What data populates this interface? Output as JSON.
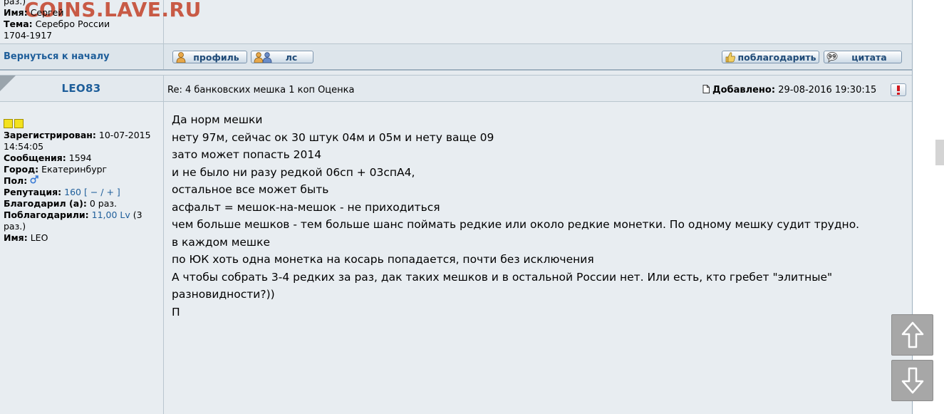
{
  "watermark": "COINS.LAVE.RU",
  "prev_user": {
    "times_suffix": "раз.)",
    "name_label": "Имя:",
    "name_value": "Сергей",
    "topic_label": "Тема:",
    "topic_value": "Серебро России",
    "topic_value2": "1704-1917"
  },
  "nav": {
    "back_to_top": "Вернуться к началу",
    "profile_button": "профиль",
    "pm_button": "лс",
    "thank_button": "поблагодарить",
    "quote_button": "цитата"
  },
  "post": {
    "author": "LEO83",
    "subject": "Re: 4 банковских мешка 1 коп Оценка",
    "added_label": "Добавлено:",
    "added_value": "29-08-2016 19:30:15",
    "report_icon": "exclamation-icon"
  },
  "user_info": {
    "registered_label": "Зарегистрирован:",
    "registered_value": "10-07-2015",
    "registered_time": "14:54:05",
    "messages_label": "Сообщения:",
    "messages_value": "1594",
    "city_label": "Город:",
    "city_value": "Екатеринбург",
    "gender_label": "Пол:",
    "gender_icon": "male-icon",
    "reputation_label": "Репутация:",
    "reputation_value": "160",
    "reputation_controls": "[ − / + ]",
    "thanked_label": "Благодарил (а):",
    "thanked_value": "0 раз.",
    "got_thanks_label": "Поблагодарили:",
    "got_thanks_value": "11,00 Lv",
    "got_thanks_count": "(3",
    "got_thanks_suffix": "раз.)",
    "name_label": "Имя:",
    "name_value": "LEO"
  },
  "message": {
    "lines": [
      "Да норм мешки",
      "нету 97м, сейчас ок 30 штук 04м и 05м и нету ваще 09",
      "зато может попасть 2014",
      "и не было ни разу редкой 06сп + 03спА4,",
      "остальное все может быть",
      "",
      "",
      "асфальт = мешок-на-мешок - не приходиться",
      "чем больше мешков - тем больше шанс поймать редкие или около редкие монетки. По одному мешку судит трудно.",
      "",
      "в каждом мешке",
      "по ЮК хоть одна монетка на косарь попадается, почти без исключения",
      "",
      "А чтобы собрать 3-4 редких за раз, дак таких мешков и в остальной России нет. Или есть, кто гребет \"элитные\"",
      "разновидности?))",
      "",
      "",
      "П"
    ]
  },
  "scroll": {
    "up_icon": "arrow-up-icon",
    "down_icon": "arrow-down-icon"
  }
}
